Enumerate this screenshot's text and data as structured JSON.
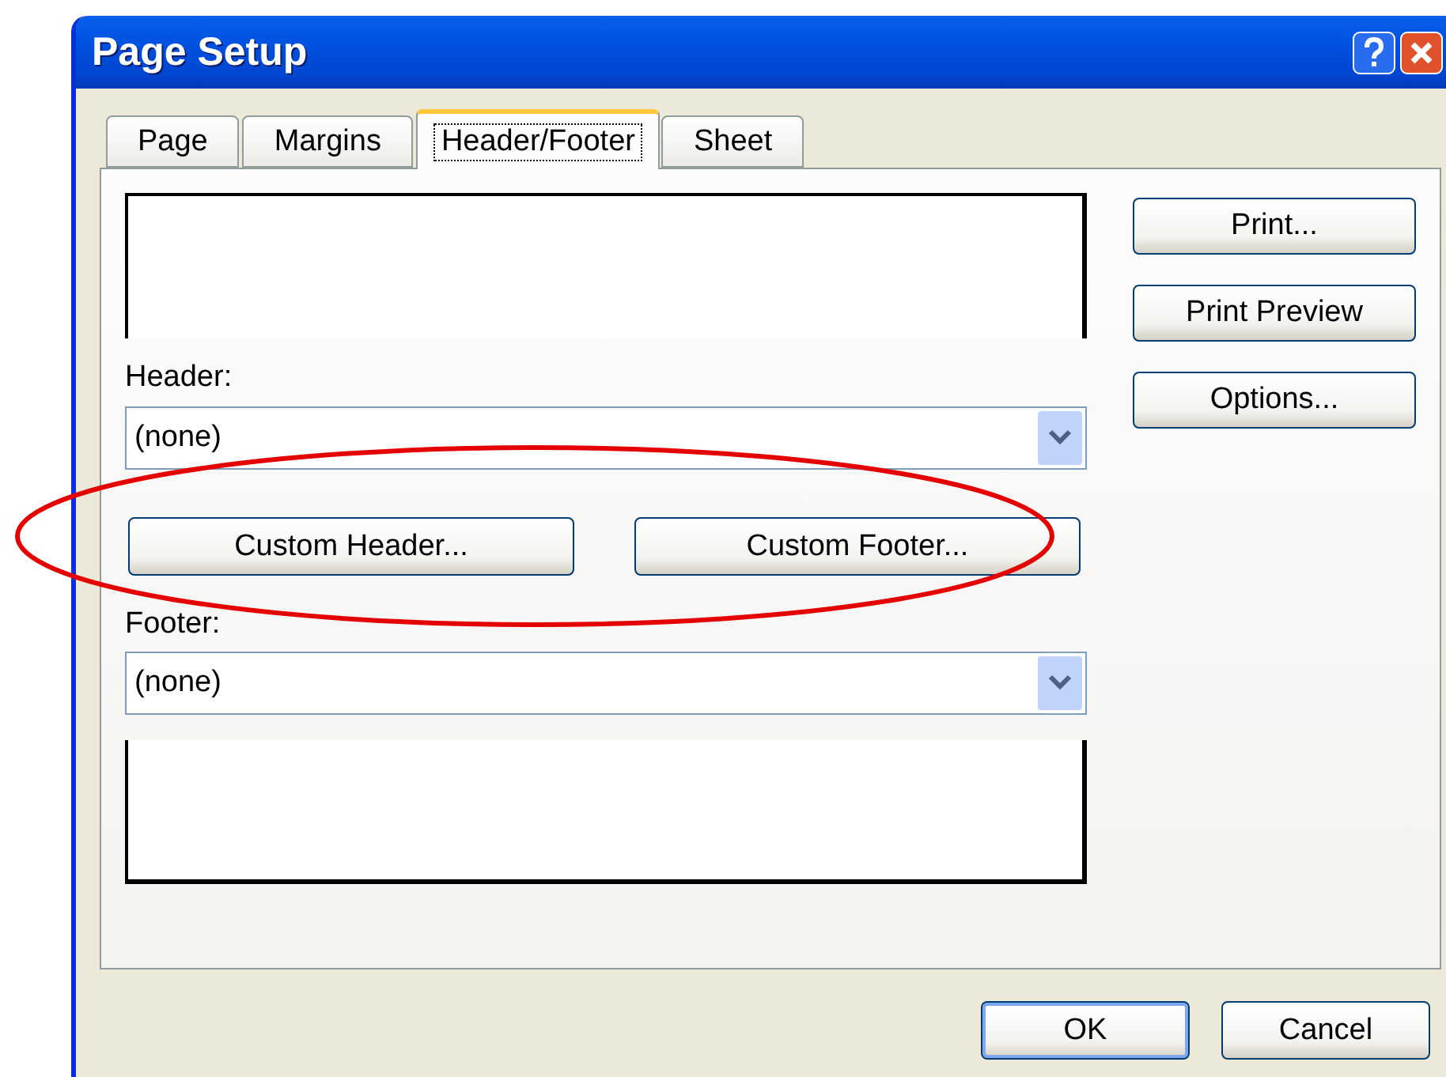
{
  "window": {
    "title": "Page Setup"
  },
  "tabs": [
    {
      "label": "Page",
      "selected": false
    },
    {
      "label": "Margins",
      "selected": false
    },
    {
      "label": "Header/Footer",
      "selected": true
    },
    {
      "label": "Sheet",
      "selected": false
    }
  ],
  "header": {
    "label": "Header:",
    "value": "(none)"
  },
  "custom_buttons": [
    "Custom Header...",
    "Custom Footer..."
  ],
  "footer": {
    "label": "Footer:",
    "value": "(none)"
  },
  "side_buttons": [
    "Print...",
    "Print Preview",
    "Options..."
  ],
  "buttons": [
    {
      "label": "OK",
      "default": true
    },
    {
      "label": "Cancel",
      "default": false
    }
  ]
}
